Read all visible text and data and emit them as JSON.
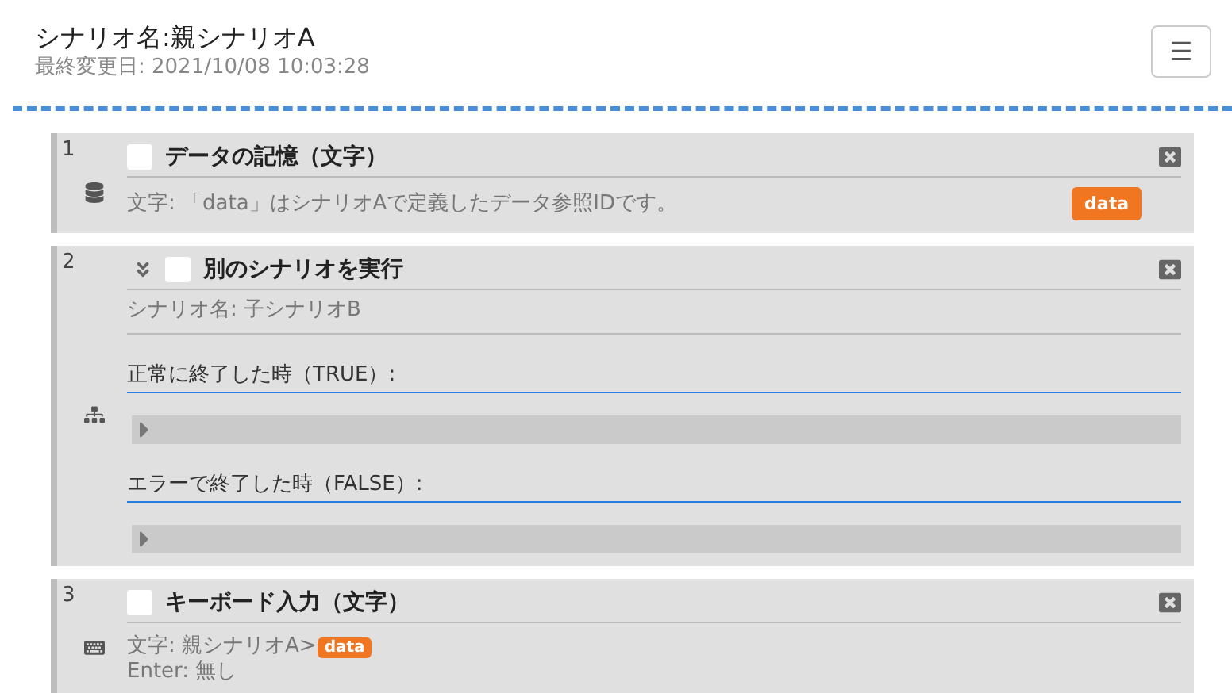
{
  "header": {
    "title": "シナリオ名:親シナリオA",
    "subtitle": "最終変更日: 2021/10/08 10:03:28",
    "menu_button": "☰"
  },
  "steps": [
    {
      "number": "1",
      "kind": "store",
      "title": "データの記憶（文字）",
      "checked": false,
      "detail": "文字: 「data」はシナリオAで定義したデータ参照IDです。",
      "badge": "data"
    },
    {
      "number": "2",
      "kind": "run_scenario",
      "title": "別のシナリオを実行",
      "checked": false,
      "expanded": true,
      "detail": "シナリオ名: 子シナリオB",
      "branches": [
        {
          "label": "正常に終了した時（TRUE）:",
          "expanded": false
        },
        {
          "label": "エラーで終了した時（FALSE）:",
          "expanded": false
        }
      ]
    },
    {
      "number": "3",
      "kind": "keyboard",
      "title": "キーボード入力（文字）",
      "checked": false,
      "lines": [
        {
          "text": "文字: 親シナリオA>",
          "badge": "data"
        },
        {
          "text": "Enter: 無し"
        }
      ]
    }
  ]
}
